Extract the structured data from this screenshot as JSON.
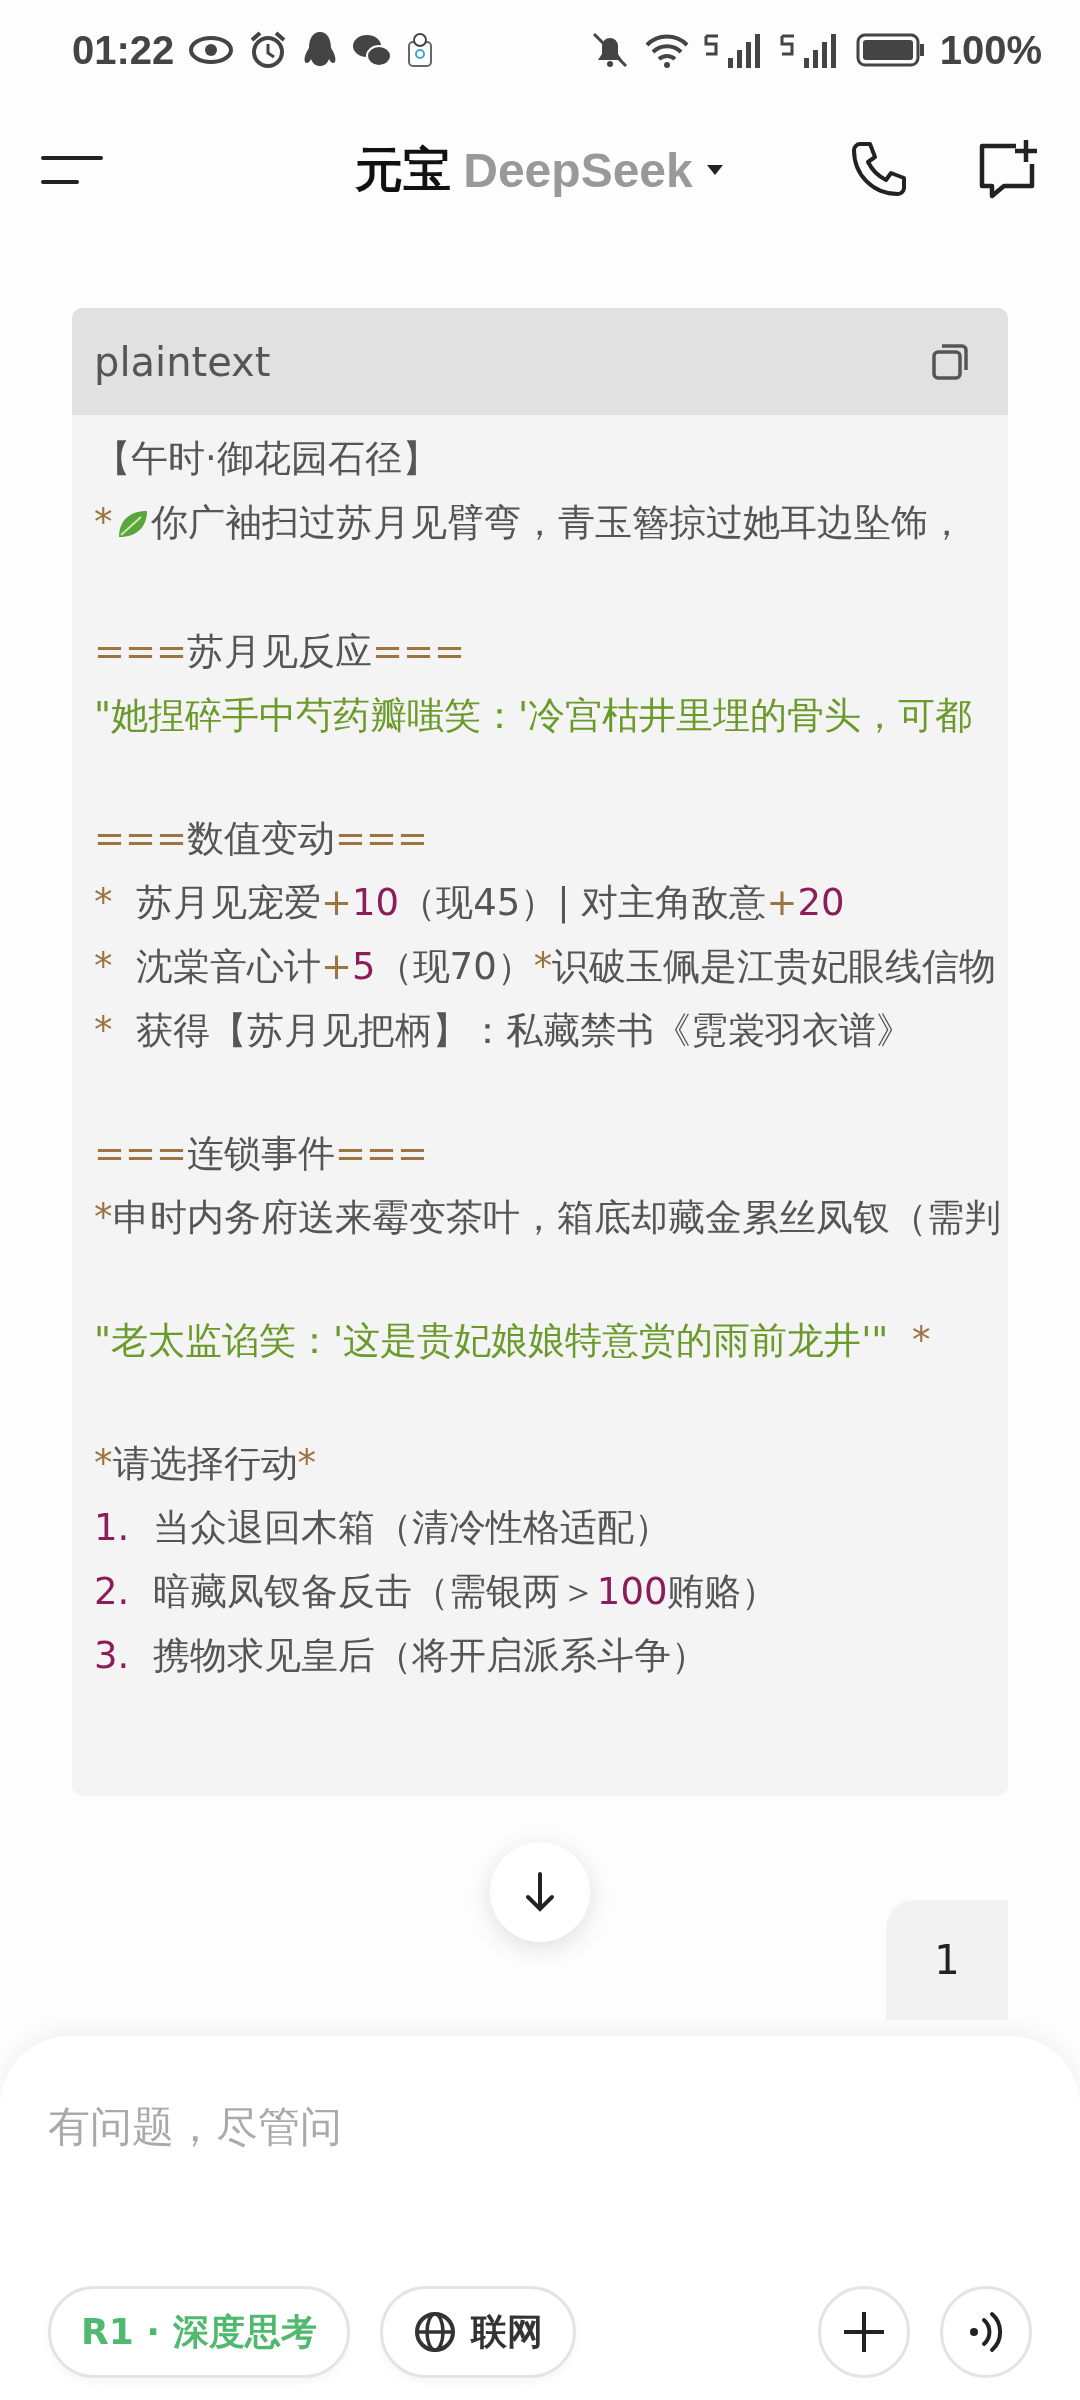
{
  "status_bar": {
    "time": "01:22",
    "battery": "100%"
  },
  "header": {
    "app_name": "元宝",
    "model": "DeepSeek"
  },
  "code_block": {
    "language": "plaintext",
    "sections": [
      [
        [
          {
            "kind": "plain",
            "text": "【午时·御花园石径】"
          }
        ],
        [
          {
            "kind": "marker",
            "text": "*"
          },
          {
            "kind": "leaf"
          },
          {
            "kind": "plain",
            "text": "你广袖扫过苏月见臂弯，青玉簪掠过她耳边坠饰，"
          }
        ]
      ],
      [
        [
          {
            "kind": "marker",
            "text": "==="
          },
          {
            "kind": "plain",
            "text": "苏月见反应"
          },
          {
            "kind": "marker",
            "text": "==="
          }
        ],
        [
          {
            "kind": "quote",
            "text": "\"她捏碎手中芍药瓣嗤笑：'冷宫枯井里埋的骨头，可都"
          }
        ]
      ],
      [
        [
          {
            "kind": "marker",
            "text": "==="
          },
          {
            "kind": "plain",
            "text": "数值变动"
          },
          {
            "kind": "marker",
            "text": "==="
          }
        ],
        [
          {
            "kind": "marker",
            "text": "*"
          },
          {
            "kind": "plain",
            "text": "  苏月见宠爱"
          },
          {
            "kind": "marker",
            "text": "+"
          },
          {
            "kind": "number",
            "text": "10"
          },
          {
            "kind": "plain",
            "text": "（现45）| 对主角敌意"
          },
          {
            "kind": "marker",
            "text": "+"
          },
          {
            "kind": "number",
            "text": "20"
          }
        ],
        [
          {
            "kind": "marker",
            "text": "*"
          },
          {
            "kind": "plain",
            "text": "  沈棠音心计"
          },
          {
            "kind": "marker",
            "text": "+"
          },
          {
            "kind": "number",
            "text": "5"
          },
          {
            "kind": "plain",
            "text": "（现70）"
          },
          {
            "kind": "marker",
            "text": "*"
          },
          {
            "kind": "plain",
            "text": "识破玉佩是江贵妃眼线信物"
          }
        ],
        [
          {
            "kind": "marker",
            "text": "*"
          },
          {
            "kind": "plain",
            "text": "  获得【苏月见把柄】：私藏禁书《霓裳羽衣谱》"
          }
        ]
      ],
      [
        [
          {
            "kind": "marker",
            "text": "==="
          },
          {
            "kind": "plain",
            "text": "连锁事件"
          },
          {
            "kind": "marker",
            "text": "==="
          }
        ],
        [
          {
            "kind": "marker",
            "text": "*"
          },
          {
            "kind": "plain",
            "text": "申时内务府送来霉变茶叶，箱底却藏金累丝凤钗（需判"
          }
        ]
      ],
      [
        [
          {
            "kind": "quote",
            "text": "\"老太监谄笑：'这是贵妃娘娘特意赏的雨前龙井'\"  "
          },
          {
            "kind": "marker",
            "text": "*"
          }
        ]
      ],
      [
        [
          {
            "kind": "marker",
            "text": "*"
          },
          {
            "kind": "plain",
            "text": "请选择行动"
          },
          {
            "kind": "marker",
            "text": "*"
          }
        ],
        [
          {
            "kind": "number",
            "text": "1."
          },
          {
            "kind": "plain",
            "text": "  当众退回木箱（清冷性格适配）"
          }
        ],
        [
          {
            "kind": "number",
            "text": "2."
          },
          {
            "kind": "plain",
            "text": "  暗藏凤钗备反击（需银两＞"
          },
          {
            "kind": "number",
            "text": "100"
          },
          {
            "kind": "plain",
            "text": "贿赂）"
          }
        ],
        [
          {
            "kind": "number",
            "text": "3."
          },
          {
            "kind": "plain",
            "text": "  携物求见皇后（将开启派系斗争）"
          }
        ]
      ]
    ]
  },
  "user_message": "1",
  "composer": {
    "placeholder": "有问题，尽管问",
    "toggles": [
      {
        "label": "R1 · 深度思考",
        "kind": "think",
        "selected": true
      },
      {
        "label": "联网",
        "kind": "web",
        "selected": false
      }
    ]
  }
}
